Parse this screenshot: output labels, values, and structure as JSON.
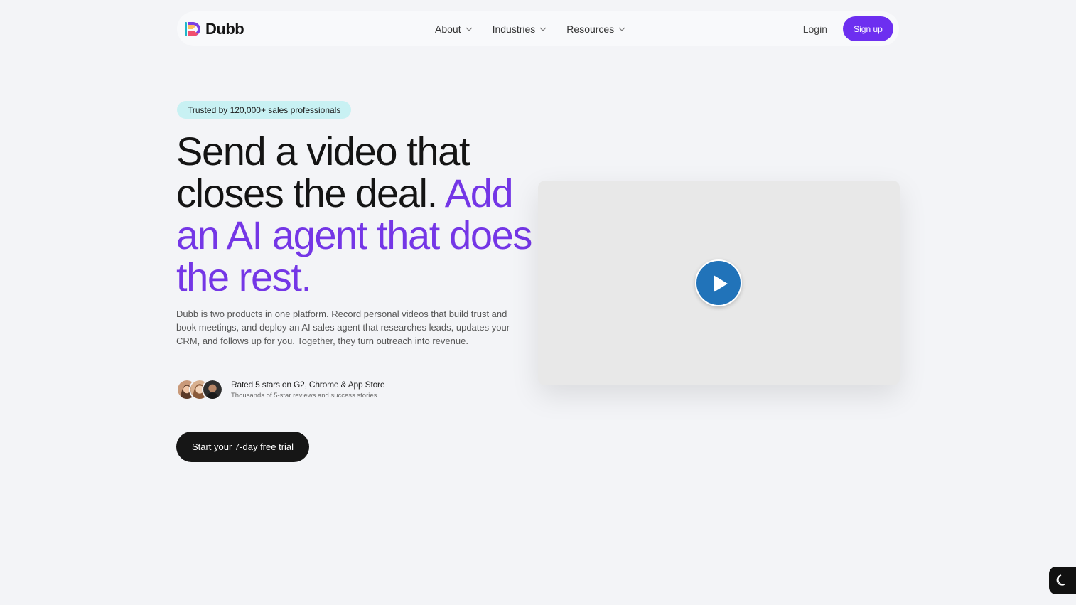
{
  "nav": {
    "brand": "Dubb",
    "links": [
      {
        "label": "About"
      },
      {
        "label": "Industries"
      },
      {
        "label": "Resources"
      }
    ],
    "login_label": "Login",
    "signup_label": "Sign up"
  },
  "hero": {
    "badge": "Trusted by 120,000+ sales professionals",
    "headline_part1": "Send a video that closes the deal.",
    "headline_accent": "Add an AI agent that does the rest.",
    "description": "Dubb is two products in one platform. Record personal videos that build trust and book meetings, and deploy an AI sales agent that researches leads, updates your CRM, and follows up for you. Together, they turn outreach into revenue.",
    "rating_title": "Rated 5 stars on G2, Chrome & App Store",
    "rating_subtitle": "Thousands of 5-star reviews and success stories",
    "cta_label": "Start your 7-day free trial"
  },
  "colors": {
    "accent": "#7436e6",
    "signup": "#6d2ff0",
    "badge_bg": "#c8f1f3",
    "play_button": "#2173b9",
    "cta_bg": "#161616"
  },
  "icons": {
    "logo": "dubb-logo",
    "chevron": "chevron-down-icon",
    "play": "play-icon",
    "theme": "moon-icon"
  }
}
